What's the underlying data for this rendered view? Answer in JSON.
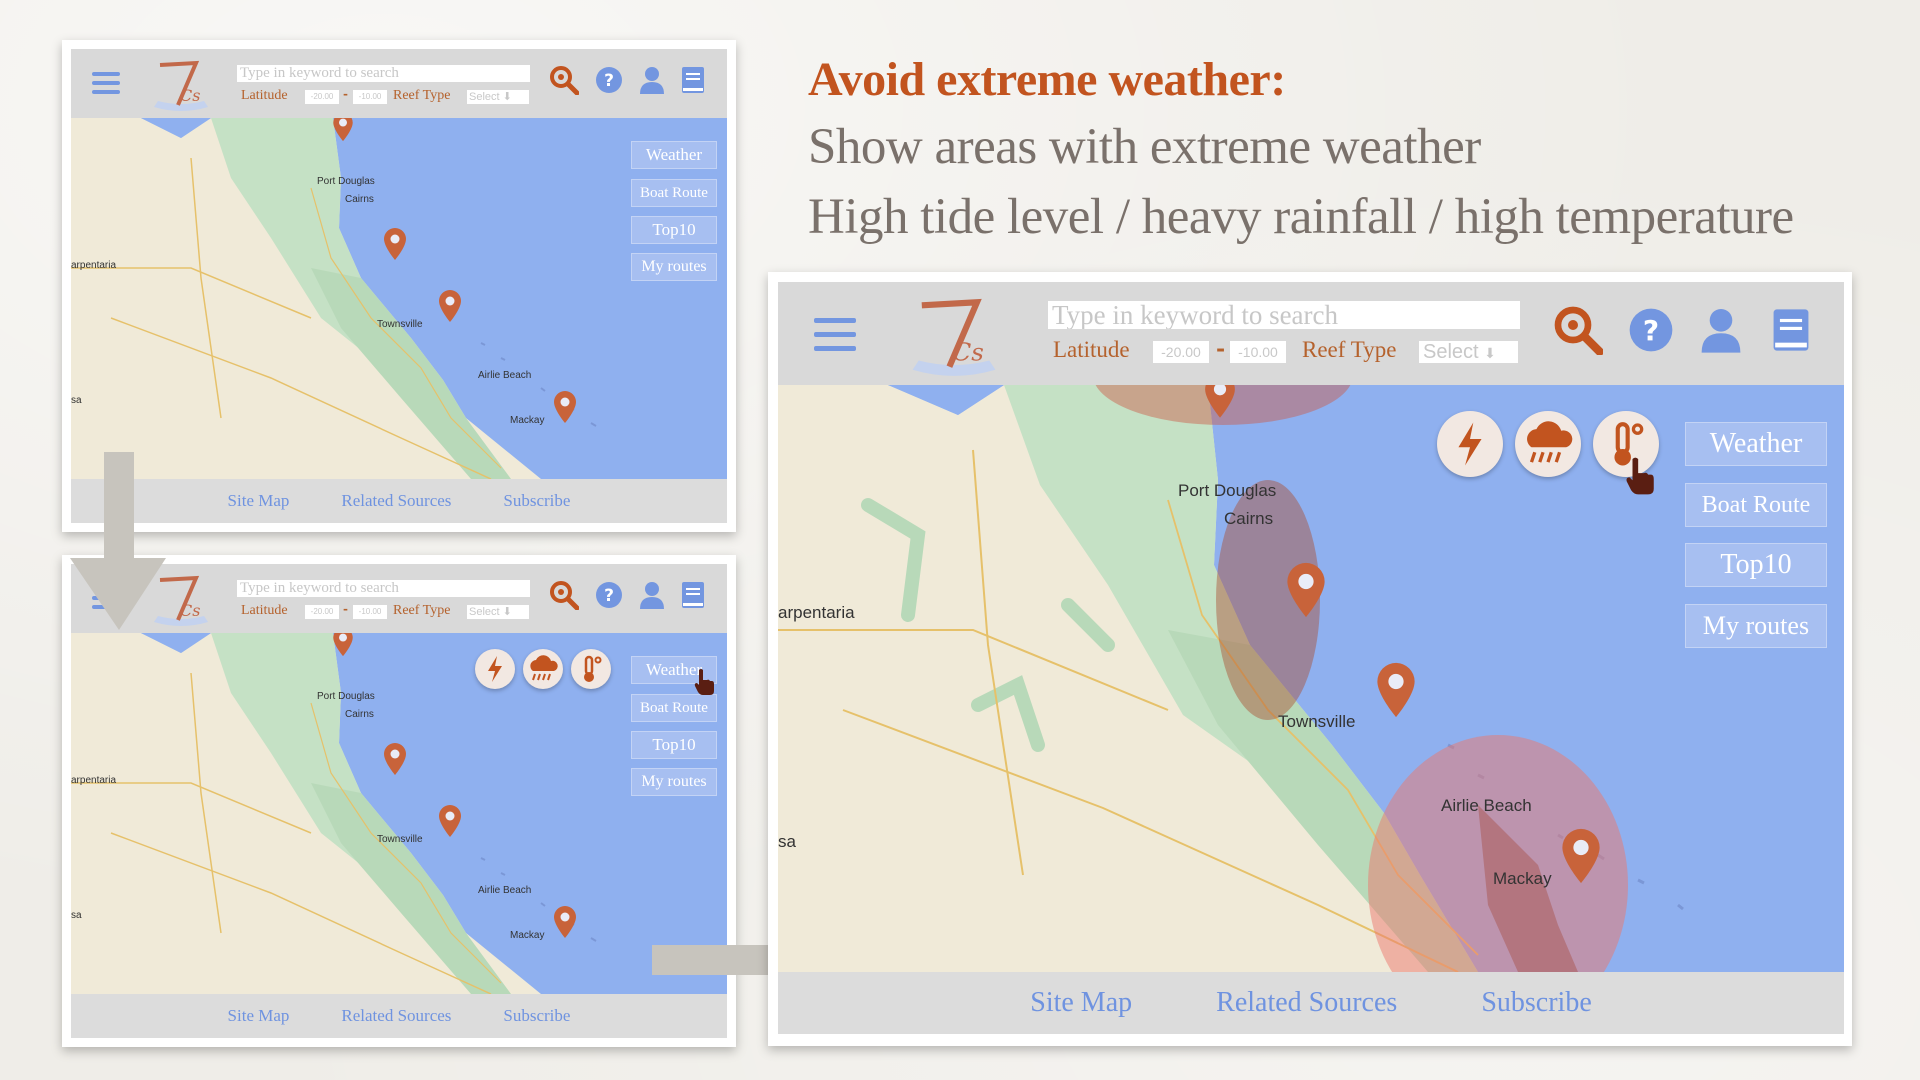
{
  "slide": {
    "title": "Avoid extreme weather:",
    "line1": "Show areas with extreme weather",
    "line2": "High tide level / heavy rainfall / high temperature"
  },
  "app": {
    "search_placeholder": "Type in keyword to search",
    "latitude_label": "Latitude",
    "lat_min": "-20.00",
    "lat_max": "-10.00",
    "reef_type_label": "Reef Type",
    "reef_type_select": "Select",
    "side_buttons": [
      "Weather",
      "Boat Route",
      "Top10",
      "My routes"
    ],
    "footer_links": [
      "Site Map",
      "Related Sources",
      "Subscribe"
    ],
    "places": {
      "port_douglas": "Port Douglas",
      "cairns": "Cairns",
      "townsville": "Townsville",
      "airlie_beach": "Airlie Beach",
      "mackay": "Mackay",
      "carpentaria": "arpentaria",
      "sa": "sa"
    },
    "weather_icons": [
      "lightning-icon",
      "rain-cloud-icon",
      "thermometer-icon"
    ]
  },
  "colors": {
    "accent": "#c2541f",
    "brand_blue": "#7396e0",
    "water": "#8fb0ef",
    "pin": "#c8633a"
  }
}
